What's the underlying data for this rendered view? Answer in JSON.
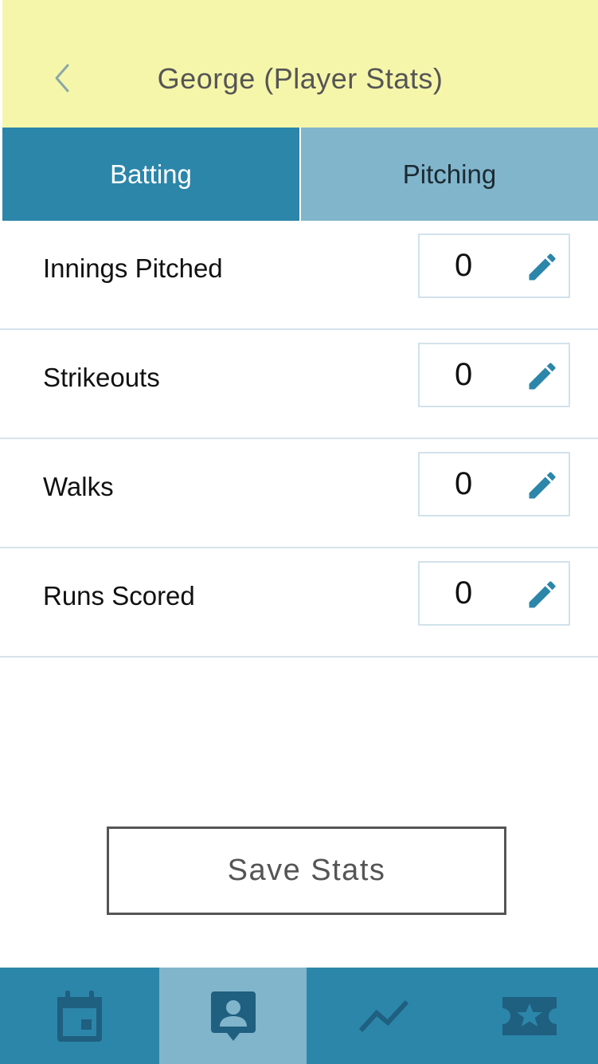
{
  "header": {
    "title": "George (Player Stats)",
    "back_icon": "chevron-left-icon"
  },
  "tabs": [
    {
      "label": "Batting",
      "active": true
    },
    {
      "label": "Pitching",
      "active": false
    }
  ],
  "stats": [
    {
      "label": "Innings Pitched",
      "value": "0",
      "action_icon": "pencil-icon"
    },
    {
      "label": "Strikeouts",
      "value": "0",
      "action_icon": "pencil-icon"
    },
    {
      "label": "Walks",
      "value": "0",
      "action_icon": "pencil-icon"
    },
    {
      "label": "Runs Scored",
      "value": "0",
      "action_icon": "pencil-icon"
    }
  ],
  "save_button": {
    "label": "Save Stats"
  },
  "bottom_nav": [
    {
      "icon": "calendar-icon",
      "active": false
    },
    {
      "icon": "person-badge-icon",
      "active": true
    },
    {
      "icon": "trend-line-icon",
      "active": false
    },
    {
      "icon": "ticket-star-icon",
      "active": false
    }
  ],
  "colors": {
    "header_bg": "#f5f6aa",
    "primary": "#2c86aa",
    "primary_light": "#81b5cb",
    "nav_icon": "#1f5f80",
    "text_dark": "#111111",
    "text_gray": "#555555"
  }
}
